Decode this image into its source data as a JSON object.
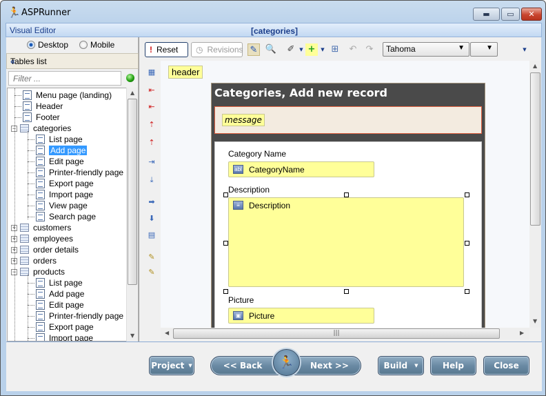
{
  "window": {
    "title": "ASPRunner",
    "minimize_icon": "minimize-icon",
    "maximize_icon": "maximize-icon",
    "close_icon": "close-icon"
  },
  "editor_bar": {
    "label": "Visual Editor",
    "title": "[categories]"
  },
  "mode": {
    "desktop_label": "Desktop",
    "mobile_label": "Mobile",
    "selected": "Desktop"
  },
  "tables_list": {
    "header": "Tables list",
    "collapse_icon": "«",
    "filter_placeholder": "Filter ...",
    "items": [
      {
        "label": "Menu page (landing)",
        "level": 0,
        "type": "page"
      },
      {
        "label": "Header",
        "level": 0,
        "type": "page"
      },
      {
        "label": "Footer",
        "level": 0,
        "type": "page"
      },
      {
        "label": "categories",
        "level": 0,
        "type": "table",
        "expanded": true
      },
      {
        "label": "List page",
        "level": 1,
        "type": "page"
      },
      {
        "label": "Add page",
        "level": 1,
        "type": "page",
        "selected": true
      },
      {
        "label": "Edit page",
        "level": 1,
        "type": "page"
      },
      {
        "label": "Printer-friendly page",
        "level": 1,
        "type": "page"
      },
      {
        "label": "Export page",
        "level": 1,
        "type": "page"
      },
      {
        "label": "Import page",
        "level": 1,
        "type": "page"
      },
      {
        "label": "View page",
        "level": 1,
        "type": "page"
      },
      {
        "label": "Search page",
        "level": 1,
        "type": "page"
      },
      {
        "label": "customers",
        "level": 0,
        "type": "table",
        "expanded": false
      },
      {
        "label": "employees",
        "level": 0,
        "type": "table",
        "expanded": false
      },
      {
        "label": "order details",
        "level": 0,
        "type": "table",
        "expanded": false
      },
      {
        "label": "orders",
        "level": 0,
        "type": "table",
        "expanded": false
      },
      {
        "label": "products",
        "level": 0,
        "type": "table",
        "expanded": true
      },
      {
        "label": "List page",
        "level": 1,
        "type": "page"
      },
      {
        "label": "Add page",
        "level": 1,
        "type": "page"
      },
      {
        "label": "Edit page",
        "level": 1,
        "type": "page"
      },
      {
        "label": "Printer-friendly page",
        "level": 1,
        "type": "page"
      },
      {
        "label": "Export page",
        "level": 1,
        "type": "page"
      },
      {
        "label": "Import page",
        "level": 1,
        "type": "page"
      }
    ]
  },
  "toolbar": {
    "reset_label": "Reset",
    "revisions_label": "Revisions",
    "font_name": "Tahoma",
    "font_size": ""
  },
  "canvas": {
    "header_tag": "header",
    "form_title": "Categories, Add new record",
    "message_tag": "message",
    "fields": [
      {
        "label": "Category Name",
        "control": "CategoryName"
      },
      {
        "label": "Description",
        "control": "Description"
      },
      {
        "label": "Picture",
        "control": "Picture"
      }
    ]
  },
  "bottom": {
    "project_label": "Project",
    "back_label": "<< Back",
    "next_label": "Next >>",
    "build_label": "Build",
    "help_label": "Help",
    "close_label": "Close"
  }
}
